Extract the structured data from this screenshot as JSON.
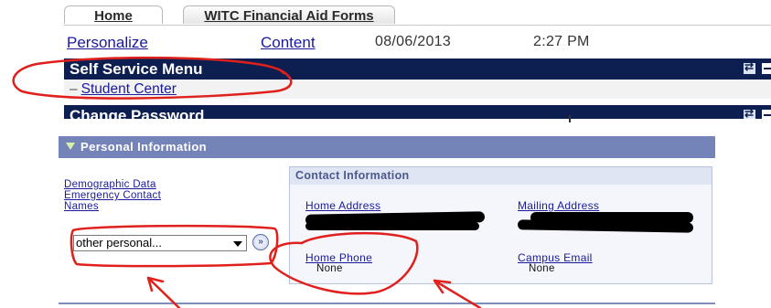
{
  "tabs": [
    {
      "label": "Home"
    },
    {
      "label": "WITC Financial Aid Forms"
    }
  ],
  "toolbar": {
    "personalize": "Personalize",
    "content": "Content",
    "date": "08/06/2013",
    "time": "2:27 PM"
  },
  "self_service": {
    "title": "Self Service Menu",
    "item": "Student Center"
  },
  "change_password": {
    "title": "Change Password"
  },
  "personal_info": {
    "title": "Personal Information",
    "links": [
      "Demographic Data",
      "Emergency Contact",
      "Names"
    ],
    "select_value": "other personal...",
    "go_label": "»"
  },
  "contact": {
    "title": "Contact Information",
    "home_address": "Home Address",
    "mailing_address": "Mailing Address",
    "home_phone": "Home Phone",
    "home_phone_value": "None",
    "campus_email": "Campus Email",
    "campus_email_value": "None"
  },
  "colors": {
    "menu_bar": "#0d1f50",
    "section_header": "#7584b8",
    "link": "#1a1a9c",
    "annotation": "#e0201c"
  }
}
